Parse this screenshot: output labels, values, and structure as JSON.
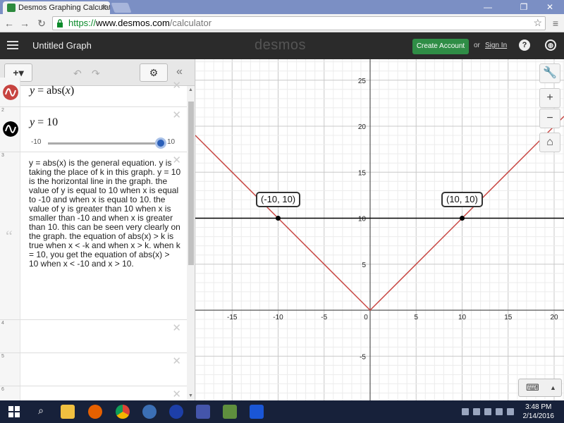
{
  "browser": {
    "tab_title": "Desmos Graphing Calculat",
    "url_https": "https://",
    "url_host": "www.desmos.com",
    "url_path": "/calculator"
  },
  "header": {
    "graph_title": "Untitled Graph",
    "brand": "desmos",
    "create_account": "Create Account",
    "or": "or",
    "sign_in": "Sign In",
    "help_icon": "question-icon",
    "language_icon": "globe-icon"
  },
  "expressions": [
    {
      "num": "1",
      "lhs": "y",
      "eq": "=",
      "fn": "abs",
      "arg": "x",
      "color": "#c74440"
    },
    {
      "num": "2",
      "lhs": "y",
      "eq": "=",
      "rhs": "10",
      "color": "#000000",
      "slider_min": "-10",
      "slider_max": "10",
      "slider_value": 10
    },
    {
      "num": "3",
      "note": "y = abs(x) is the general equation.  y is taking the place of k in this graph.  y = 10 is the horizontal line in the graph.   the value of y is equal to 10 when x is equal to -10 and when x is equal to 10.   the value of y is greater than 10 when x is smaller than -10 and when x is greater than 10.  this can be seen very clearly on the graph.  the equation of abs(x) > k is true when x < -k and when x > k.   when k = 10, you get the equation of abs(x) > 10 when x < -10 and x > 10."
    },
    {
      "num": "4"
    },
    {
      "num": "5"
    },
    {
      "num": "6"
    }
  ],
  "graph": {
    "x_ticks": [
      "-15",
      "-10",
      "-5",
      "0",
      "5",
      "10",
      "15",
      "20"
    ],
    "y_ticks": [
      "25",
      "20",
      "15",
      "10",
      "5",
      "-5"
    ],
    "points": [
      {
        "label": "(-10, 10)",
        "x": -10,
        "y": 10
      },
      {
        "label": "(10, 10)",
        "x": 10,
        "y": 10
      }
    ],
    "curve_color": "#c74440",
    "line_color": "#000000"
  },
  "taskbar": {
    "time": "3:48 PM",
    "date": "2/14/2016"
  }
}
